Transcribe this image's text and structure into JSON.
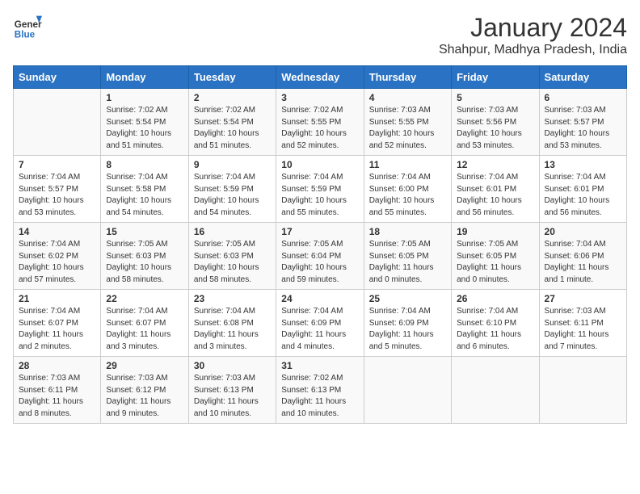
{
  "logo": {
    "line1": "General",
    "line2": "Blue"
  },
  "title": "January 2024",
  "subtitle": "Shahpur, Madhya Pradesh, India",
  "weekdays": [
    "Sunday",
    "Monday",
    "Tuesday",
    "Wednesday",
    "Thursday",
    "Friday",
    "Saturday"
  ],
  "weeks": [
    [
      {
        "day": "",
        "info": ""
      },
      {
        "day": "1",
        "info": "Sunrise: 7:02 AM\nSunset: 5:54 PM\nDaylight: 10 hours\nand 51 minutes."
      },
      {
        "day": "2",
        "info": "Sunrise: 7:02 AM\nSunset: 5:54 PM\nDaylight: 10 hours\nand 51 minutes."
      },
      {
        "day": "3",
        "info": "Sunrise: 7:02 AM\nSunset: 5:55 PM\nDaylight: 10 hours\nand 52 minutes."
      },
      {
        "day": "4",
        "info": "Sunrise: 7:03 AM\nSunset: 5:55 PM\nDaylight: 10 hours\nand 52 minutes."
      },
      {
        "day": "5",
        "info": "Sunrise: 7:03 AM\nSunset: 5:56 PM\nDaylight: 10 hours\nand 53 minutes."
      },
      {
        "day": "6",
        "info": "Sunrise: 7:03 AM\nSunset: 5:57 PM\nDaylight: 10 hours\nand 53 minutes."
      }
    ],
    [
      {
        "day": "7",
        "info": "Sunrise: 7:04 AM\nSunset: 5:57 PM\nDaylight: 10 hours\nand 53 minutes."
      },
      {
        "day": "8",
        "info": "Sunrise: 7:04 AM\nSunset: 5:58 PM\nDaylight: 10 hours\nand 54 minutes."
      },
      {
        "day": "9",
        "info": "Sunrise: 7:04 AM\nSunset: 5:59 PM\nDaylight: 10 hours\nand 54 minutes."
      },
      {
        "day": "10",
        "info": "Sunrise: 7:04 AM\nSunset: 5:59 PM\nDaylight: 10 hours\nand 55 minutes."
      },
      {
        "day": "11",
        "info": "Sunrise: 7:04 AM\nSunset: 6:00 PM\nDaylight: 10 hours\nand 55 minutes."
      },
      {
        "day": "12",
        "info": "Sunrise: 7:04 AM\nSunset: 6:01 PM\nDaylight: 10 hours\nand 56 minutes."
      },
      {
        "day": "13",
        "info": "Sunrise: 7:04 AM\nSunset: 6:01 PM\nDaylight: 10 hours\nand 56 minutes."
      }
    ],
    [
      {
        "day": "14",
        "info": "Sunrise: 7:04 AM\nSunset: 6:02 PM\nDaylight: 10 hours\nand 57 minutes."
      },
      {
        "day": "15",
        "info": "Sunrise: 7:05 AM\nSunset: 6:03 PM\nDaylight: 10 hours\nand 58 minutes."
      },
      {
        "day": "16",
        "info": "Sunrise: 7:05 AM\nSunset: 6:03 PM\nDaylight: 10 hours\nand 58 minutes."
      },
      {
        "day": "17",
        "info": "Sunrise: 7:05 AM\nSunset: 6:04 PM\nDaylight: 10 hours\nand 59 minutes."
      },
      {
        "day": "18",
        "info": "Sunrise: 7:05 AM\nSunset: 6:05 PM\nDaylight: 11 hours\nand 0 minutes."
      },
      {
        "day": "19",
        "info": "Sunrise: 7:05 AM\nSunset: 6:05 PM\nDaylight: 11 hours\nand 0 minutes."
      },
      {
        "day": "20",
        "info": "Sunrise: 7:04 AM\nSunset: 6:06 PM\nDaylight: 11 hours\nand 1 minute."
      }
    ],
    [
      {
        "day": "21",
        "info": "Sunrise: 7:04 AM\nSunset: 6:07 PM\nDaylight: 11 hours\nand 2 minutes."
      },
      {
        "day": "22",
        "info": "Sunrise: 7:04 AM\nSunset: 6:07 PM\nDaylight: 11 hours\nand 3 minutes."
      },
      {
        "day": "23",
        "info": "Sunrise: 7:04 AM\nSunset: 6:08 PM\nDaylight: 11 hours\nand 3 minutes."
      },
      {
        "day": "24",
        "info": "Sunrise: 7:04 AM\nSunset: 6:09 PM\nDaylight: 11 hours\nand 4 minutes."
      },
      {
        "day": "25",
        "info": "Sunrise: 7:04 AM\nSunset: 6:09 PM\nDaylight: 11 hours\nand 5 minutes."
      },
      {
        "day": "26",
        "info": "Sunrise: 7:04 AM\nSunset: 6:10 PM\nDaylight: 11 hours\nand 6 minutes."
      },
      {
        "day": "27",
        "info": "Sunrise: 7:03 AM\nSunset: 6:11 PM\nDaylight: 11 hours\nand 7 minutes."
      }
    ],
    [
      {
        "day": "28",
        "info": "Sunrise: 7:03 AM\nSunset: 6:11 PM\nDaylight: 11 hours\nand 8 minutes."
      },
      {
        "day": "29",
        "info": "Sunrise: 7:03 AM\nSunset: 6:12 PM\nDaylight: 11 hours\nand 9 minutes."
      },
      {
        "day": "30",
        "info": "Sunrise: 7:03 AM\nSunset: 6:13 PM\nDaylight: 11 hours\nand 10 minutes."
      },
      {
        "day": "31",
        "info": "Sunrise: 7:02 AM\nSunset: 6:13 PM\nDaylight: 11 hours\nand 10 minutes."
      },
      {
        "day": "",
        "info": ""
      },
      {
        "day": "",
        "info": ""
      },
      {
        "day": "",
        "info": ""
      }
    ]
  ]
}
